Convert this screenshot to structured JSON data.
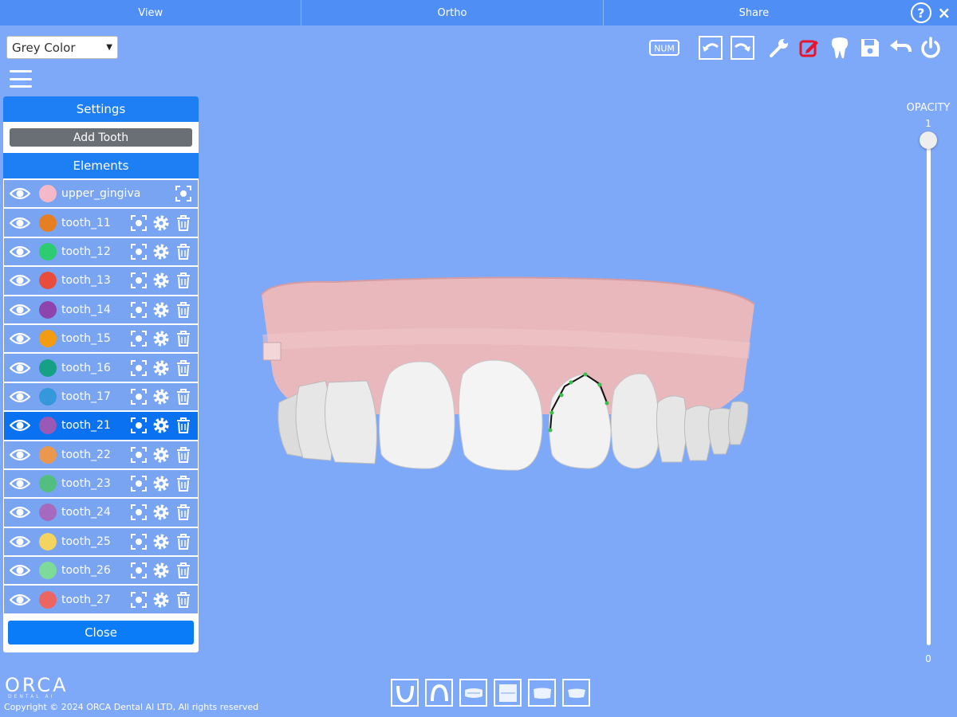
{
  "topbar": {
    "menus": [
      {
        "label": "View"
      },
      {
        "label": "Ortho"
      },
      {
        "label": "Share"
      }
    ],
    "help_label": "?",
    "close_label": "×"
  },
  "color_select": {
    "value": "Grey Color"
  },
  "toolbar": {
    "num_label": "NUM",
    "icons": [
      "num-icon",
      "rotate-left-icon",
      "rotate-right-icon",
      "wrench-icon",
      "edit-icon",
      "tooth-icon",
      "save-icon",
      "undo-icon",
      "power-icon"
    ],
    "edit_color": "#e8142c"
  },
  "panel": {
    "settings_label": "Settings",
    "add_tooth_label": "Add Tooth",
    "elements_label": "Elements",
    "close_label": "Close",
    "items": [
      {
        "name": "upper_gingiva",
        "color": "#f5b8c8",
        "selected": false,
        "gingiva": true
      },
      {
        "name": "tooth_11",
        "color": "#e67e22",
        "selected": false
      },
      {
        "name": "tooth_12",
        "color": "#2ecc71",
        "selected": false
      },
      {
        "name": "tooth_13",
        "color": "#e74c3c",
        "selected": false
      },
      {
        "name": "tooth_14",
        "color": "#8e44ad",
        "selected": false
      },
      {
        "name": "tooth_15",
        "color": "#f39c12",
        "selected": false
      },
      {
        "name": "tooth_16",
        "color": "#16a085",
        "selected": false
      },
      {
        "name": "tooth_17",
        "color": "#3498db",
        "selected": false
      },
      {
        "name": "tooth_21",
        "color": "#9b59b6",
        "selected": true
      },
      {
        "name": "tooth_22",
        "color": "#eb984e",
        "selected": false
      },
      {
        "name": "tooth_23",
        "color": "#52be80",
        "selected": false
      },
      {
        "name": "tooth_24",
        "color": "#a569bd",
        "selected": false
      },
      {
        "name": "tooth_25",
        "color": "#f4d35e",
        "selected": false
      },
      {
        "name": "tooth_26",
        "color": "#7ddb9a",
        "selected": false
      },
      {
        "name": "tooth_27",
        "color": "#ec6560",
        "selected": false
      }
    ]
  },
  "opacity": {
    "label": "OPACITY",
    "max": "1",
    "min": "0",
    "value": 1
  },
  "footer": {
    "brand": "ORCA",
    "brand_sub": "DENTAL AI",
    "copyright": "Copyright © 2024 ORCA Dental AI LTD, All rights reserved"
  },
  "views": [
    "lower-arch-view-icon",
    "upper-arch-view-icon",
    "front-view-icon",
    "full-view-icon",
    "side-view-icon",
    "back-view-icon"
  ]
}
